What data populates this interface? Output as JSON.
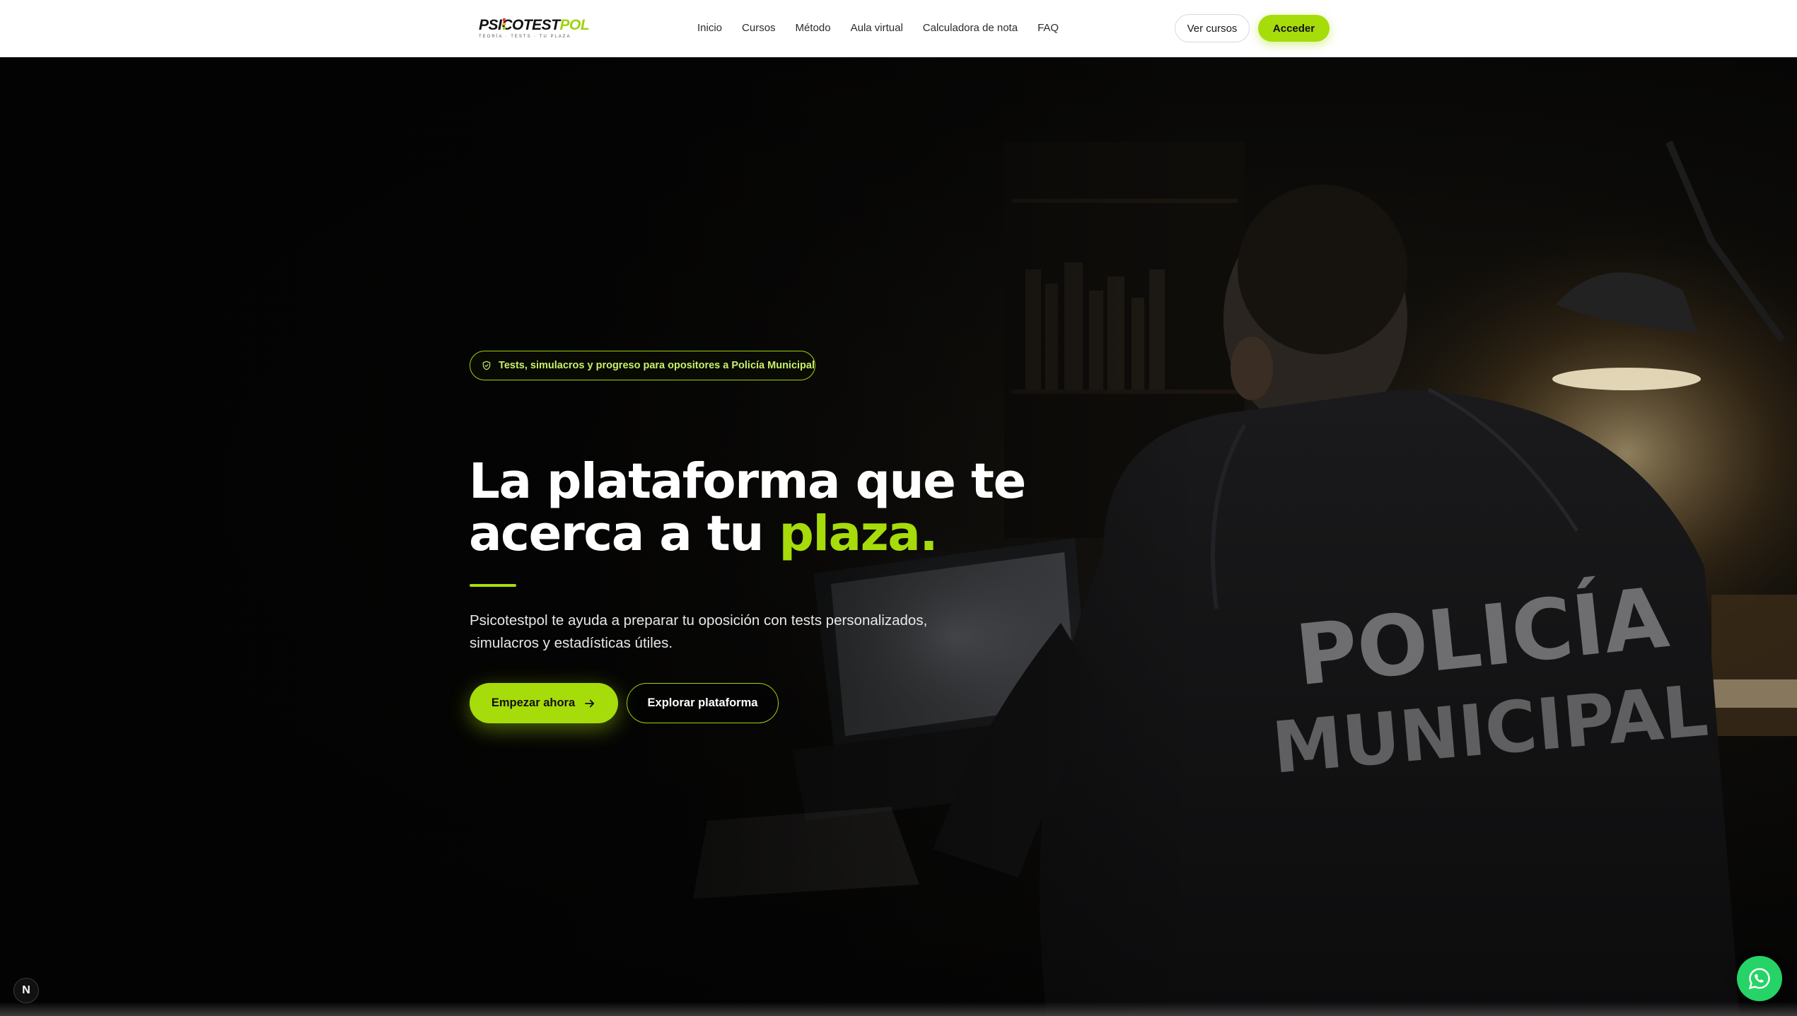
{
  "brand": {
    "name_main": "PSICOTEST",
    "name_accent": "POL",
    "tagline": "TEORÍA · TESTS · TU PLAZA",
    "accent_color": "#a6dc0a"
  },
  "nav": {
    "links": [
      "Inicio",
      "Cursos",
      "Método",
      "Aula virtual",
      "Calculadora de nota",
      "FAQ"
    ],
    "ver_cursos": "Ver cursos",
    "acceder": "Acceder"
  },
  "hero": {
    "badge_icon": "shield-check-icon",
    "badge_text": "Tests, simulacros y progreso para opositores a Policía Municipal",
    "headline_line1": "La plataforma que te",
    "headline_line2": "acerca a tu ",
    "headline_highlight": "plaza.",
    "subtitle": "Psicotestpol te ayuda a preparar tu oposición con tests personalizados, simulacros y estadísticas útiles.",
    "cta_primary": "Empezar ahora",
    "cta_primary_icon": "arrow-right-icon",
    "cta_secondary": "Explorar plataforma",
    "jacket_text_1": "POLICÍA",
    "jacket_text_2": "MUNICIPAL"
  },
  "floating": {
    "dev_badge": "N",
    "whatsapp_icon": "whatsapp-icon",
    "whatsapp_color": "#25d366"
  }
}
